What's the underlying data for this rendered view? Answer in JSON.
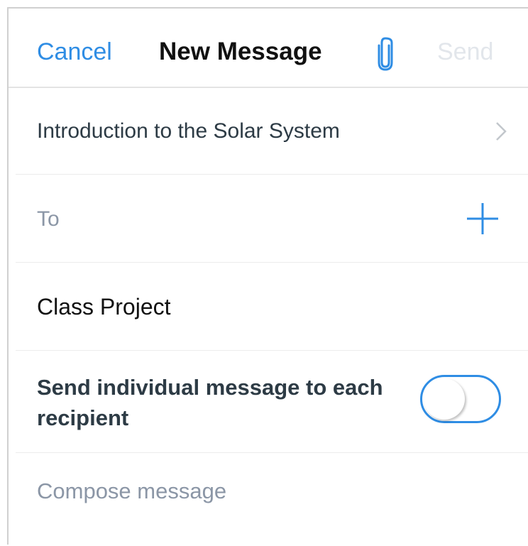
{
  "header": {
    "cancel_label": "Cancel",
    "title": "New Message",
    "attach_icon": "paperclip-icon",
    "send_label": "Send"
  },
  "course": {
    "label": "Introduction to the Solar System",
    "chevron_icon": "chevron-right-icon"
  },
  "recipients": {
    "label": "To",
    "add_icon": "plus-icon"
  },
  "subject": {
    "value": "Class Project"
  },
  "individual": {
    "label": "Send individual message to each recipient",
    "enabled": false
  },
  "compose": {
    "placeholder": "Compose message"
  },
  "colors": {
    "accent": "#2f8de4",
    "text_dark": "#2d3b45",
    "placeholder": "#8b96a6",
    "send_disabled": "#e2e6eb",
    "divider": "#ececec"
  }
}
